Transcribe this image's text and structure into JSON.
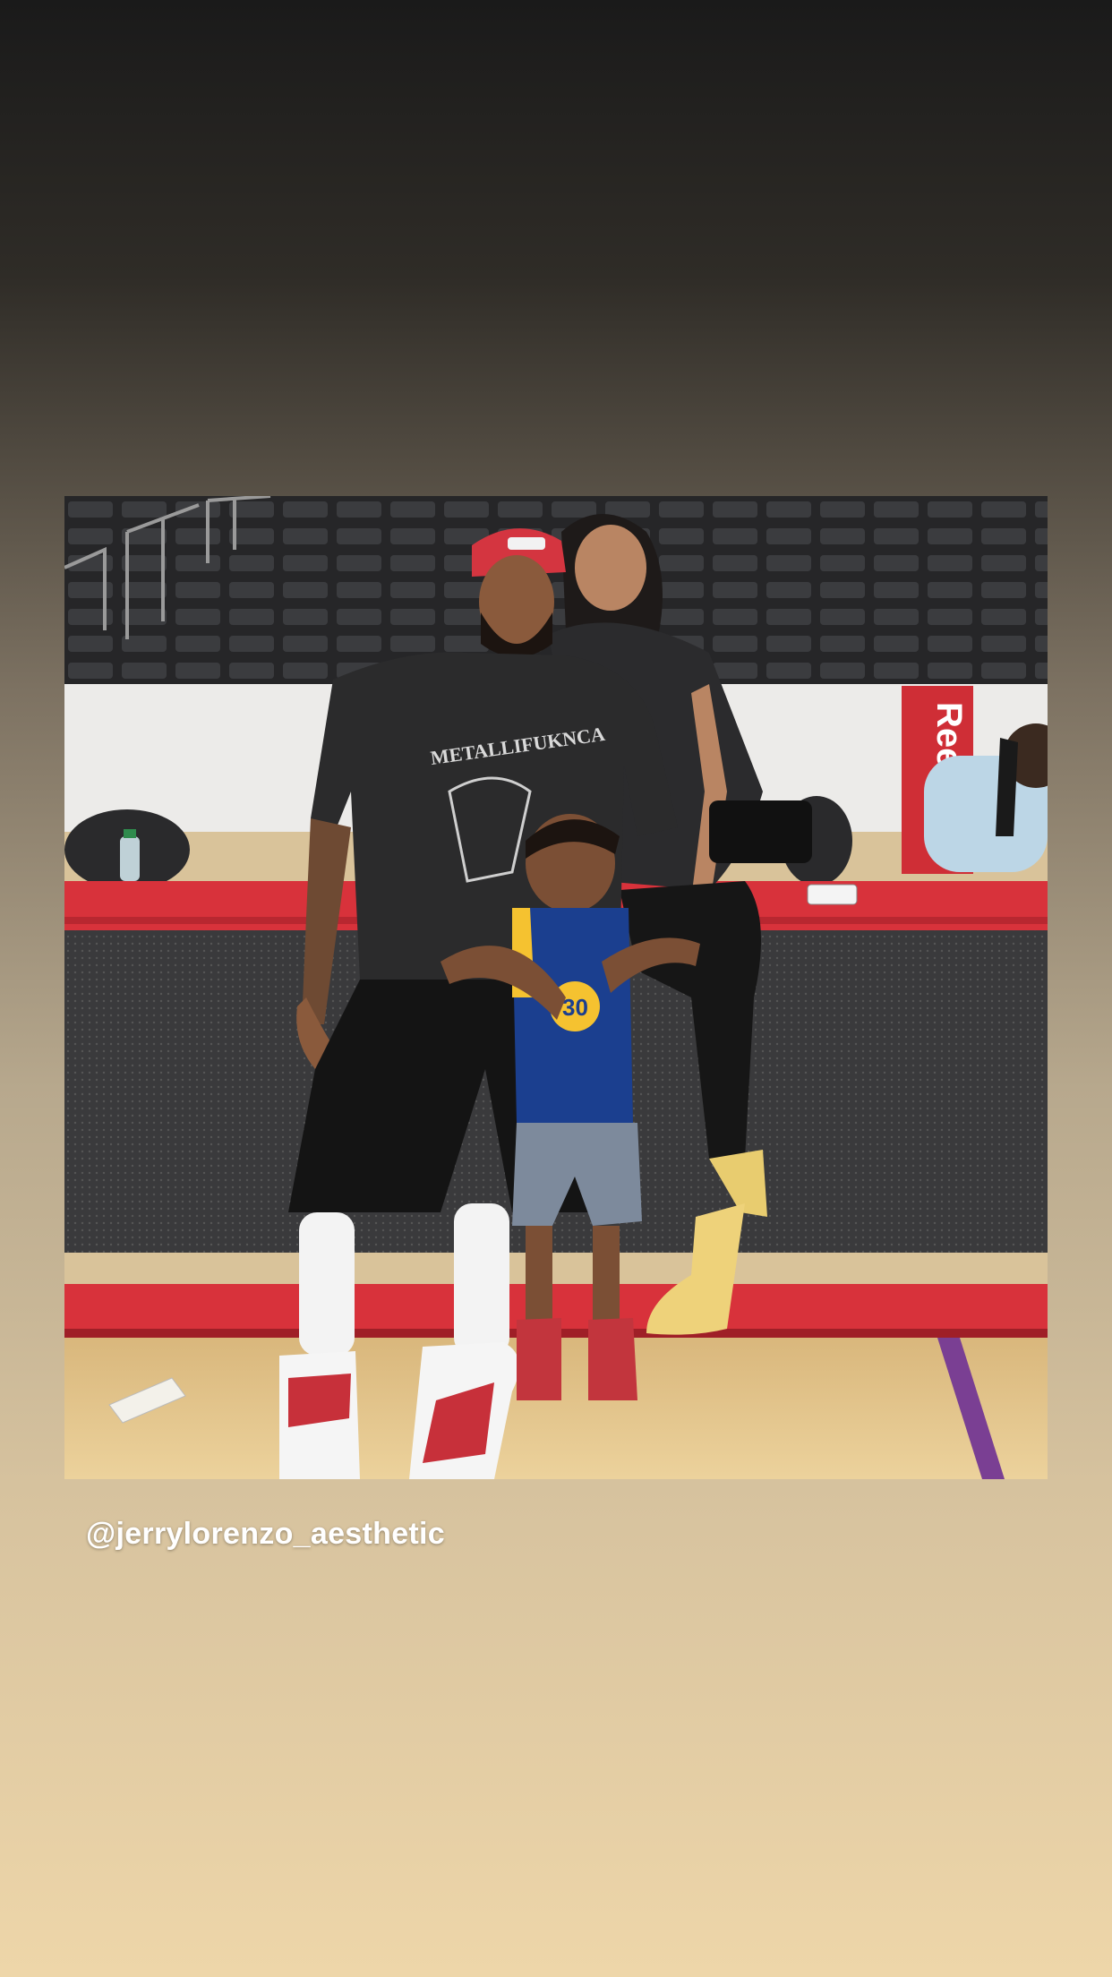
{
  "story": {
    "mention": "@jerrylorenzo_aesthetic",
    "shirt_text": "METALLIFUKNCA",
    "jersey_number": "30",
    "sponsor_banner": "Reebok"
  },
  "colors": {
    "background_top": "#1a1a1a",
    "background_bottom": "#eed6a9",
    "court_red": "#d8323b",
    "court_floor": "#e7c98f",
    "court_purple_line": "#7a3f93"
  },
  "icons": {
    "photo": "family-courtside-photo"
  }
}
